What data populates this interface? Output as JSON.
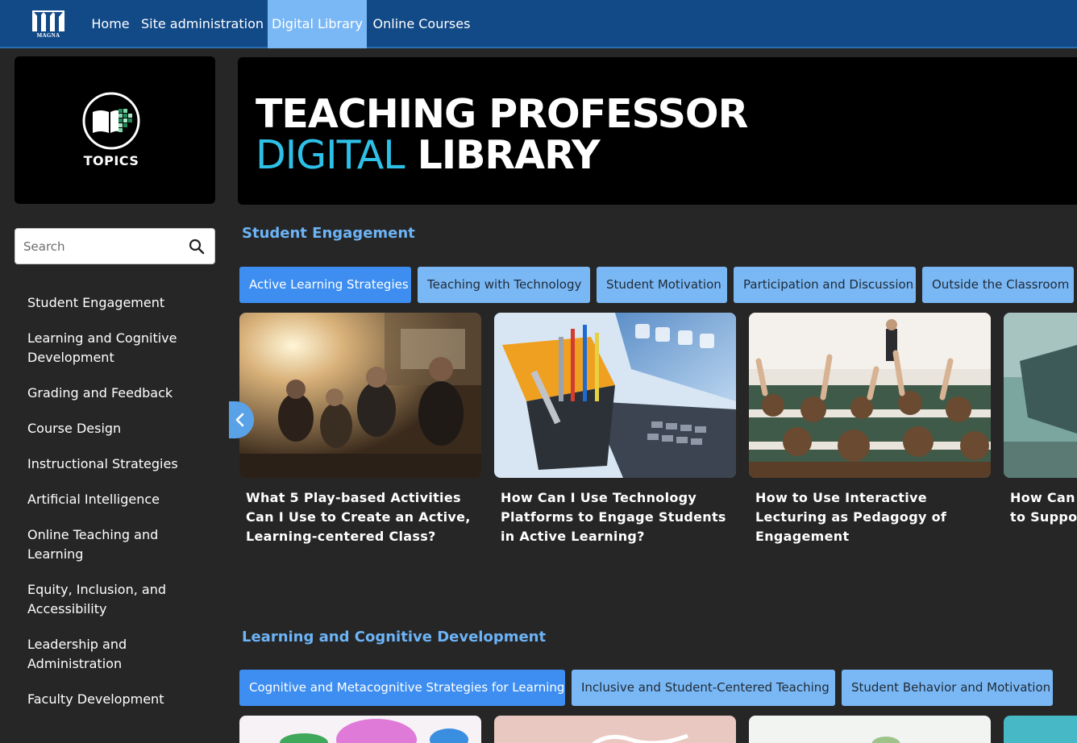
{
  "nav": {
    "logo_text": "MAGNA",
    "links": [
      "Home",
      "Site administration",
      "Digital Library",
      "Online Courses"
    ],
    "active_index": 2
  },
  "sidebar": {
    "topics_label": "TOPICS",
    "search_placeholder": "Search",
    "search_value": "",
    "items": [
      "Student Engagement",
      "Learning and Cognitive Development",
      "Grading and Feedback",
      "Course Design",
      "Instructional Strategies",
      "Artificial Intelligence",
      "Online Teaching and Learning",
      "Equity, Inclusion, and Accessibility",
      "Leadership and Administration",
      "Faculty Development"
    ]
  },
  "banner": {
    "line1": "TEACHING PROFESSOR",
    "line2_a": "DIGITAL",
    "line2_b": "LIBRARY"
  },
  "sections": [
    {
      "title": "Student Engagement",
      "tabs": [
        "Active Learning Strategies",
        "Teaching with Technology",
        "Student Motivation",
        "Participation and Discussion",
        "Outside the Classroom"
      ],
      "active_tab": 0,
      "cards": [
        {
          "title": "What 5 Play-based Activities Can I Use to Create an Active, Learning-centered Class?"
        },
        {
          "title": "How Can I Use Technology Platforms to Engage Students in Active Learning?"
        },
        {
          "title": "How to Use Interactive Lecturing as Pedagogy of Engagement"
        },
        {
          "title": "How Can I ... to Suppor..."
        }
      ]
    },
    {
      "title": "Learning and Cognitive Development",
      "tabs": [
        "Cognitive and Metacognitive Strategies for Learning",
        "Inclusive and Student-Centered Teaching",
        "Student Behavior and Motivation"
      ],
      "active_tab": 0
    }
  ],
  "colors": {
    "nav_bg": "#124a88",
    "nav_active": "#7ab8f5",
    "page_bg": "#262626",
    "section_title": "#6cb4f7",
    "pill": "#7ab8f5",
    "pill_active": "#3d8ef0",
    "banner_accent": "#2ec1e8"
  },
  "icons": {
    "logo": "magna-logo-icon",
    "topics": "book-topics-icon",
    "search": "search-icon",
    "carousel_prev": "chevron-left-icon"
  }
}
